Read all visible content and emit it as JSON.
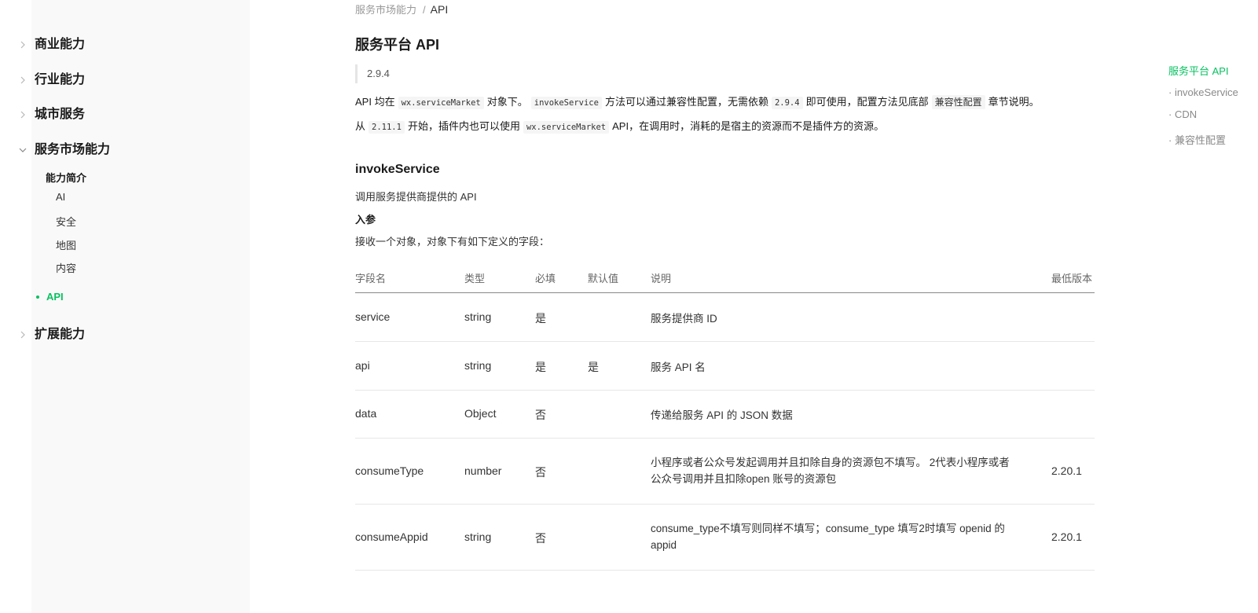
{
  "sidebar": {
    "top_items": [
      {
        "label": "商业能力",
        "expanded": false
      },
      {
        "label": "行业能力",
        "expanded": false
      },
      {
        "label": "城市服务",
        "expanded": false
      },
      {
        "label": "服务市场能力",
        "expanded": true
      },
      {
        "label": "扩展能力",
        "expanded": false
      }
    ],
    "sub_heading": "能力简介",
    "sub_items": [
      "AI",
      "安全",
      "地图",
      "内容"
    ],
    "active_item": "API"
  },
  "breadcrumb": {
    "parent": "服务市场能力",
    "separator": "/",
    "current": "API"
  },
  "page_title": "服务平台 API",
  "version": "2.9.4",
  "intro": {
    "p1": {
      "t1": "API 均在",
      "code1": "wx.serviceMarket",
      "t2": "对象下。",
      "code2": "invokeService",
      "t3": "方法可以通过兼容性配置，无需依赖",
      "code3": "2.9.4",
      "t4": "即可使用，配置方法见底部",
      "code4": "兼容性配置",
      "t5": "章节说明。"
    },
    "p2": {
      "t1": "从",
      "code1": "2.11.1",
      "t2": "开始，插件内也可以使用",
      "code2": "wx.serviceMarket",
      "t3": "API，在调用时，消耗的是宿主的资源而不是插件方的资源。"
    }
  },
  "section": {
    "title": "invokeService",
    "desc": "调用服务提供商提供的 API",
    "params_label": "入参",
    "params_desc": "接收一个对象，对象下有如下定义的字段："
  },
  "table": {
    "headers": [
      "字段名",
      "类型",
      "必填",
      "默认值",
      "说明",
      "最低版本"
    ],
    "rows": [
      [
        "service",
        "string",
        "是",
        "",
        "服务提供商 ID",
        ""
      ],
      [
        "api",
        "string",
        "是",
        "是",
        "服务 API 名",
        ""
      ],
      [
        "data",
        "Object",
        "否",
        "",
        "传递给服务 API 的 JSON 数据",
        ""
      ],
      [
        "consumeType",
        "number",
        "否",
        "",
        "小程序或者公众号发起调用并且扣除自身的资源包不填写。 2代表小程序或者公众号调用并且扣除open 账号的资源包",
        "2.20.1"
      ],
      [
        "consumeAppid",
        "string",
        "否",
        "",
        "consume_type不填写则同样不填写；consume_type 填写2时填写 openid 的appid",
        "2.20.1"
      ]
    ]
  },
  "toc": {
    "items": [
      "服务平台 API",
      "· invokeService",
      "· CDN",
      "· 兼容性配置"
    ],
    "active_index": 0
  },
  "colors": {
    "accent": "#07c160",
    "sidebar_bg": "#f9f9f9"
  }
}
